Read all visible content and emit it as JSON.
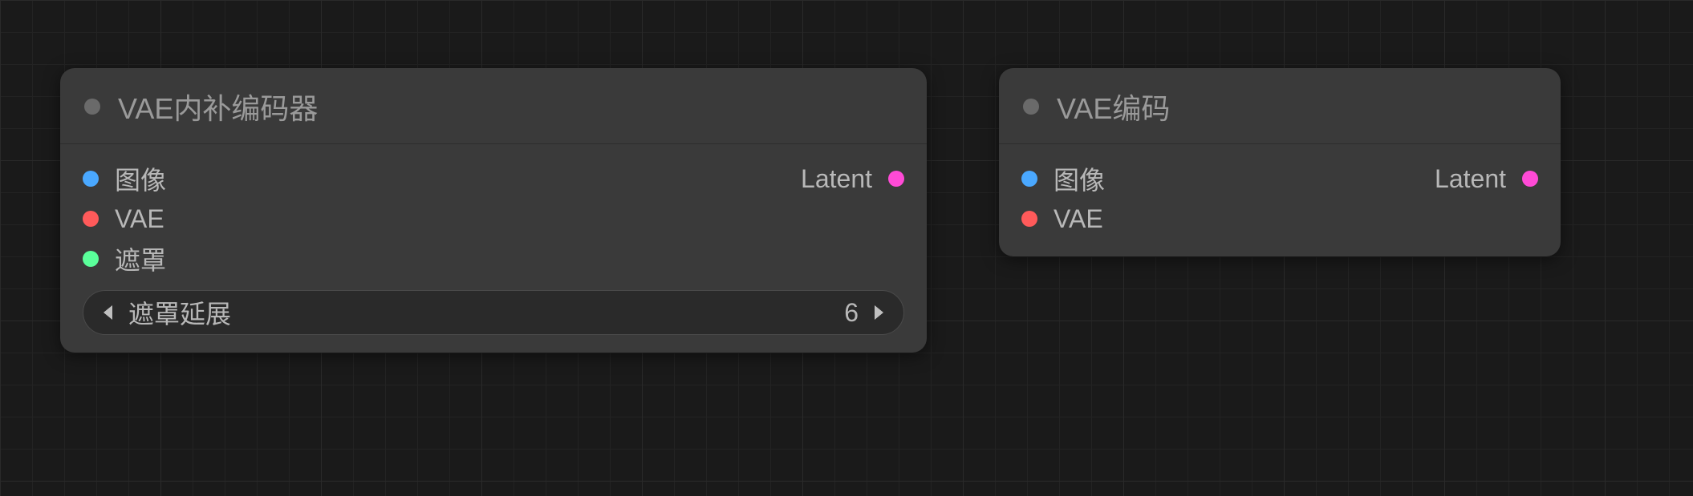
{
  "nodes": [
    {
      "title": "VAE内补编码器",
      "inputs": [
        {
          "label": "图像",
          "color": "blue"
        },
        {
          "label": "VAE",
          "color": "red"
        },
        {
          "label": "遮罩",
          "color": "green"
        }
      ],
      "outputs": [
        {
          "label": "Latent",
          "color": "magenta"
        }
      ],
      "widget": {
        "label": "遮罩延展",
        "value": "6"
      }
    },
    {
      "title": "VAE编码",
      "inputs": [
        {
          "label": "图像",
          "color": "blue"
        },
        {
          "label": "VAE",
          "color": "red"
        }
      ],
      "outputs": [
        {
          "label": "Latent",
          "color": "magenta"
        }
      ]
    }
  ]
}
